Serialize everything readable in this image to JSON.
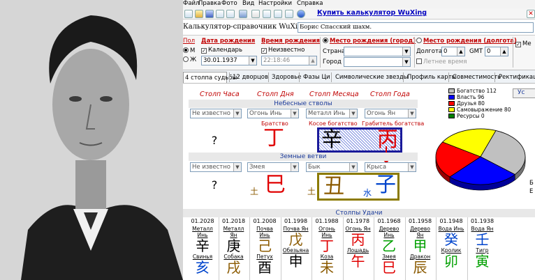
{
  "menu": [
    "Файл",
    "Правка",
    "Фото",
    "Вид",
    "Настройки",
    "Справка"
  ],
  "toolbar": {
    "buy_label": "Купить калькулятор WuXing"
  },
  "window": {
    "title": "Калькулятор-справочник WuXing",
    "name_value": "Борис Спасский шахм."
  },
  "form": {
    "sex_label": "Пол",
    "sex_m": "М",
    "sex_f": "Ж",
    "birth_date_label": "Дата рождения",
    "calendar_label": "Календарь",
    "birth_date_value": "30.01.1937",
    "birth_time_label": "Время рождения",
    "unknown_label": "Неизвестно",
    "birth_time_value": "22:18:46",
    "place_city_label": "Место рождения (город)",
    "country_label": "Страна",
    "city_label": "Город",
    "place_long_label": "Место рождения (долгота)",
    "longitude_label": "Долгота",
    "longitude_value": "0",
    "gmt_label": "GMT",
    "gmt_value": "0",
    "summer_time_label": "Летнее время",
    "me_label": "Ме"
  },
  "tabs": [
    "4 столпа судьбы",
    "12 дворцов",
    "Здоровье",
    "Фазы Ци",
    "Символические звезды",
    "Профиль карты",
    "Совместимость",
    "Ректификация"
  ],
  "pillars": {
    "headers": [
      "Столп Часа",
      "Столп Дня",
      "Столп Месяца",
      "Столп Года"
    ],
    "stems_title": "Небесные стволы",
    "stem_selects": [
      "Не известно",
      "Огонь Инь",
      "Металл Инь",
      "Огонь Ян"
    ],
    "stem_roles": [
      "",
      "Братство",
      "Косое богатство",
      "Грабитель богатства"
    ],
    "stem_chars": [
      "?",
      "丁",
      "辛",
      "丙"
    ],
    "branches_title": "Земные ветви",
    "branch_selects": [
      "Не известно",
      "Змея",
      "Бык",
      "Крыса"
    ],
    "branch_chars": [
      "?",
      "巳",
      "丑",
      "子"
    ],
    "branch_elements": [
      "",
      "土",
      "土",
      "水"
    ]
  },
  "chart": {
    "button": "Ус",
    "legend": [
      {
        "label": "Богатство",
        "value": "112",
        "color": "#c0c0c0"
      },
      {
        "label": "Власть",
        "value": "96",
        "color": "#0000ff"
      },
      {
        "label": "Друзья",
        "value": "80",
        "color": "#ff0000"
      },
      {
        "label": "Самовыражение",
        "value": "80",
        "color": "#ffff00"
      },
      {
        "label": "Ресурсы",
        "value": "0",
        "color": "#008000"
      }
    ],
    "side_letter_top": "Б",
    "side_letter_bottom": "Е"
  },
  "chart_data": {
    "type": "pie",
    "categories": [
      "Богатство",
      "Власть",
      "Друзья",
      "Самовыражение",
      "Ресурсы"
    ],
    "values": [
      112,
      96,
      80,
      80,
      0
    ]
  },
  "luck": {
    "title": "Столпы Удачи",
    "columns": [
      {
        "year": "01.2028",
        "stem_name": "Металл Инь",
        "stem": "辛",
        "stem_color": "#000000",
        "branch": "亥",
        "branch_color": "#0044cc",
        "animal": "Свинья"
      },
      {
        "year": "01.2018",
        "stem_name": "Металл Ян",
        "stem": "庚",
        "stem_color": "#000000",
        "branch": "戌",
        "branch_color": "#8b5a00",
        "animal": "Собака"
      },
      {
        "year": "01.2008",
        "stem_name": "Почва Инь",
        "stem": "己",
        "stem_color": "#8b5a00",
        "branch": "酉",
        "branch_color": "#000000",
        "animal": "Петух"
      },
      {
        "year": "01.1998",
        "stem_name": "Почва Ян",
        "stem": "戊",
        "stem_color": "#8b5a00",
        "branch": "申",
        "branch_color": "#000000",
        "animal": "Обезьяна"
      },
      {
        "year": "01.1988",
        "stem_name": "Огонь Инь",
        "stem": "丁",
        "stem_color": "#e00000",
        "branch": "未",
        "branch_color": "#8b5a00",
        "animal": "Коза"
      },
      {
        "year": "01.1978",
        "stem_name": "Огонь Ян",
        "stem": "丙",
        "stem_color": "#e00000",
        "branch": "午",
        "branch_color": "#e00000",
        "animal": "Лошадь"
      },
      {
        "year": "01.1968",
        "stem_name": "Дерево Инь",
        "stem": "乙",
        "stem_color": "#00a000",
        "branch": "巳",
        "branch_color": "#e00000",
        "animal": "Змея"
      },
      {
        "year": "01.1958",
        "stem_name": "Дерево Ян",
        "stem": "甲",
        "stem_color": "#00a000",
        "branch": "辰",
        "branch_color": "#8b5a00",
        "animal": "Дракон"
      },
      {
        "year": "01.1948",
        "stem_name": "Вода Инь",
        "stem": "癸",
        "stem_color": "#0044cc",
        "branch": "卯",
        "branch_color": "#00a000",
        "animal": "Кролик"
      },
      {
        "year": "01.1938",
        "stem_name": "Вода Ян",
        "stem": "壬",
        "stem_color": "#0044cc",
        "branch": "寅",
        "branch_color": "#00a000",
        "animal": "Тигр"
      }
    ]
  }
}
